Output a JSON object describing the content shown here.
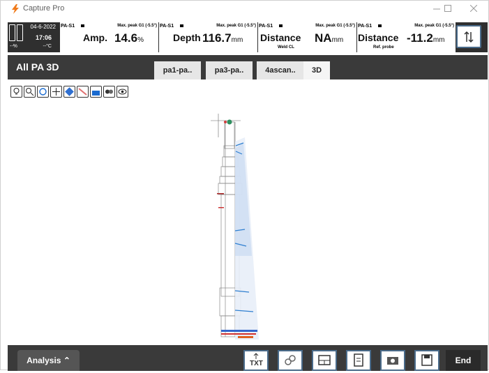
{
  "app": {
    "title": "Capture Pro"
  },
  "status": {
    "date": "04-6-2022",
    "time": "17:06",
    "battery": "--%",
    "temp": "--°C"
  },
  "gates": [
    {
      "probe": "PA-S1",
      "peak": "Max. peak G1 (-5.5°)",
      "name": "Amp.",
      "value": "14.6",
      "unit": "%",
      "sub": ""
    },
    {
      "probe": "PA-S1",
      "peak": "Max. peak G1 (-5.5°)",
      "name": "Depth",
      "value": "116.7",
      "unit": "mm",
      "sub": ""
    },
    {
      "probe": "PA-S1",
      "peak": "Max. peak G1 (-5.5°)",
      "name": "Distance",
      "value": "NA",
      "unit": "mm",
      "sub": "Weld CL"
    },
    {
      "probe": "PA-S1",
      "peak": "Max. peak G1 (-5.5°)",
      "name": "Distance",
      "value": "-11.2",
      "unit": "mm",
      "sub": "Ref. probe"
    }
  ],
  "header": {
    "title": "All PA 3D"
  },
  "tabs": [
    {
      "label": "pa1-pa..",
      "active": false
    },
    {
      "label": "pa3-pa..",
      "active": false
    },
    {
      "label": "4ascan..",
      "active": false
    },
    {
      "label": "3D",
      "active": true
    }
  ],
  "tools": [
    "bulb-icon",
    "zoom-icon",
    "rotate-icon",
    "pan-icon",
    "probe-hand-icon",
    "cut-plane-icon",
    "3d-view-icon",
    "layers-icon",
    "eye-icon"
  ],
  "bottom": {
    "analysis_label": "Analysis",
    "buttons": [
      "export-txt-icon",
      "link-icon",
      "layout-icon",
      "report-icon",
      "camera-icon",
      "save-icon"
    ],
    "end_label": "End"
  },
  "colors": {
    "accent": "#4a6b8a",
    "dark": "#3a3a3a",
    "logo": "#f07a1a"
  }
}
